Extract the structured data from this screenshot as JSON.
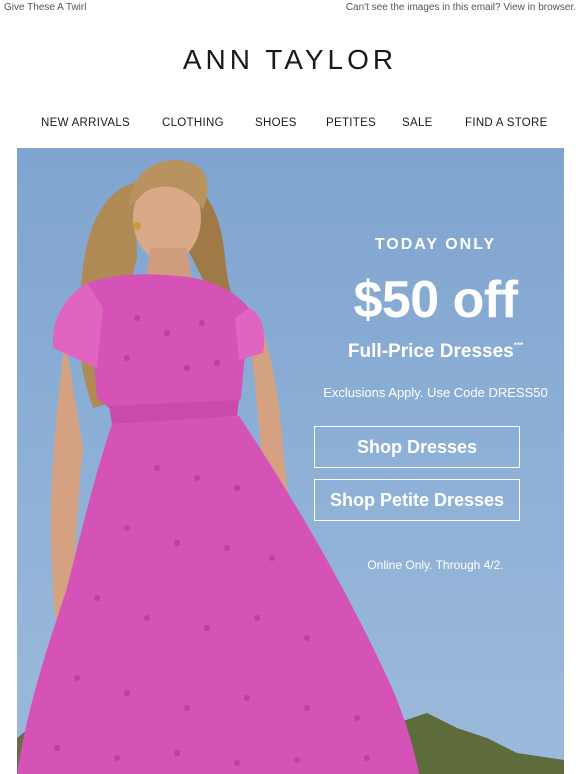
{
  "preheader": {
    "left_text": "Give These A Twirl",
    "right_text": "Can't see the images in this email? View in browser."
  },
  "brand": {
    "logo_text": "ANN TAYLOR"
  },
  "nav": {
    "items": [
      "NEW ARRIVALS",
      "CLOTHING",
      "SHOES",
      "PETITES",
      "SALE",
      "FIND A STORE"
    ]
  },
  "hero": {
    "headline": "TODAY ONLY",
    "amount": "$50 off",
    "subline": "Full-Price Dresses",
    "subline_mark": "***",
    "exclusions": "Exclusions Apply. Use Code DRESS50",
    "buttons": [
      "Shop Dresses",
      "Shop Petite Dresses"
    ],
    "footnote": "Online Only. Through 4/2.",
    "colors": {
      "sky": "#8fb1d7",
      "dress": "#d552b6",
      "text": "#ffffff"
    }
  }
}
